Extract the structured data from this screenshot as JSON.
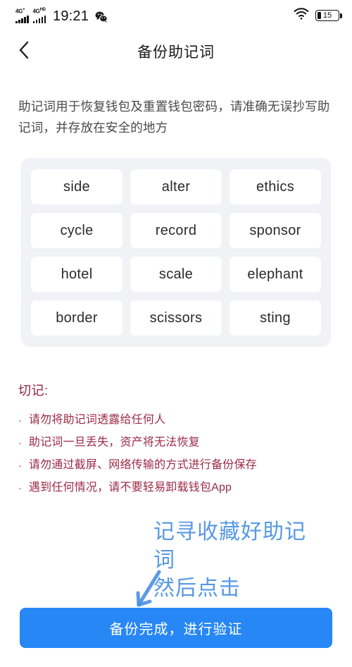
{
  "status_bar": {
    "signal_1_label": "4G",
    "signal_1_sup": "+",
    "signal_2_label": "4G",
    "signal_2_sup": "HD",
    "time": "19:21",
    "wechat_icon": "wechat-icon",
    "wifi_icon": "wifi-icon",
    "battery_level": "15"
  },
  "nav": {
    "back_icon": "chevron-left-icon",
    "title": "备份助记词"
  },
  "description": "助记词用于恢复钱包及重置钱包密码，请准确无误抄写助记词，并存放在安全的地方",
  "mnemonic": {
    "words": [
      "side",
      "alter",
      "ethics",
      "cycle",
      "record",
      "sponsor",
      "hotel",
      "scale",
      "elephant",
      "border",
      "scissors",
      "sting"
    ]
  },
  "warnings": {
    "title": "切记:",
    "bullet": "·",
    "items": [
      "请勿将助记词透露给任何人",
      "助记词一旦丢失，资产将无法恢复",
      "请勿通过截屏、网络传输的方式进行备份保存",
      "遇到任何情况，请不要轻易卸载钱包App"
    ]
  },
  "annotation": {
    "line1": "记寻收藏好助记",
    "line2": "词",
    "line3": "然后点击",
    "arrow_icon": "arrow-down-left-icon",
    "color": "#4a90e2"
  },
  "cta": {
    "label": "备份完成，进行验证",
    "color": "#2787f5"
  }
}
